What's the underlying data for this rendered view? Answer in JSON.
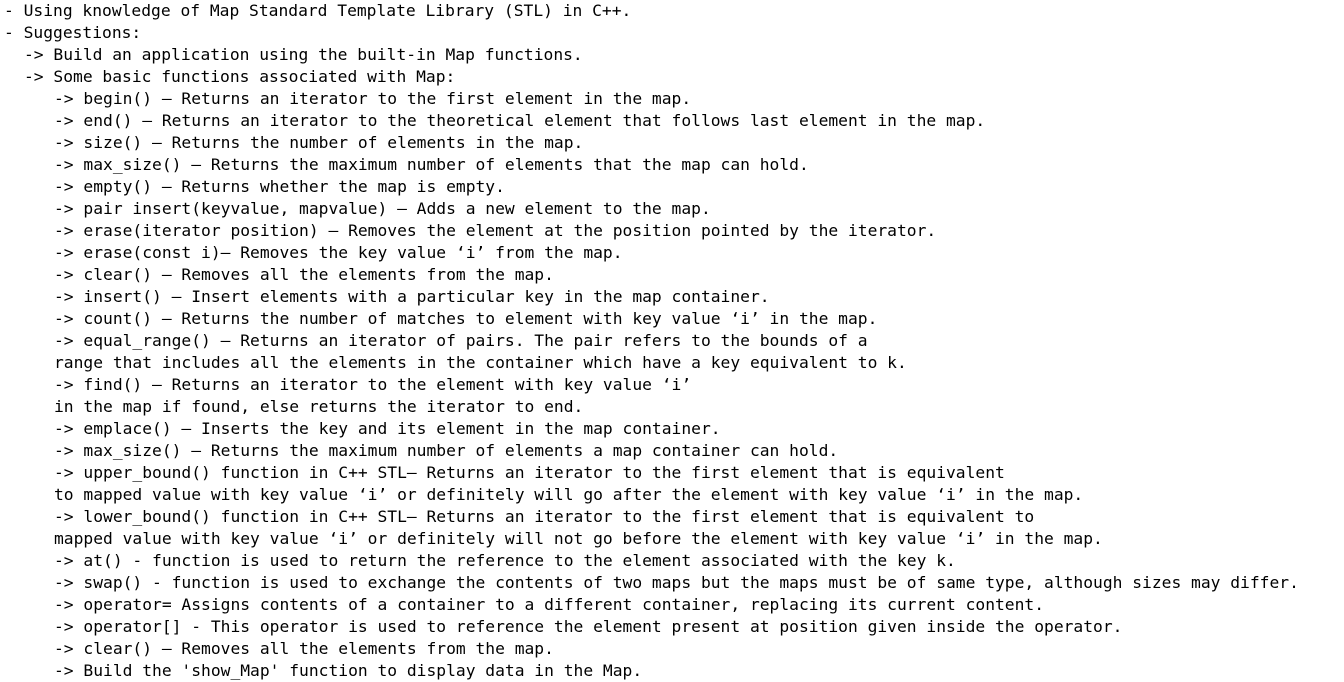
{
  "document": {
    "lines": [
      "- Using knowledge of Map Standard Template Library (STL) in C++.",
      "- Suggestions:",
      "-> Build an application using the built-in Map functions.",
      "-> Some basic functions associated with Map:",
      "-> begin() – Returns an iterator to the first element in the map.",
      "-> end() – Returns an iterator to the theoretical element that follows last element in the map.",
      "-> size() – Returns the number of elements in the map.",
      "-> max_size() – Returns the maximum number of elements that the map can hold.",
      "-> empty() – Returns whether the map is empty.",
      "-> pair insert(keyvalue, mapvalue) – Adds a new element to the map.",
      "-> erase(iterator position) – Removes the element at the position pointed by the iterator.",
      "-> erase(const i)– Removes the key value ‘i’ from the map.",
      "-> clear() – Removes all the elements from the map.",
      "-> insert() – Insert elements with a particular key in the map container.",
      "-> count() – Returns the number of matches to element with key value ‘i’ in the map.",
      "-> equal_range() – Returns an iterator of pairs. The pair refers to the bounds of a",
      "range that includes all the elements in the container which have a key equivalent to k.",
      "-> find() – Returns an iterator to the element with key value ‘i’",
      "in the map if found, else returns the iterator to end.",
      "-> emplace() – Inserts the key and its element in the map container.",
      "-> max_size() – Returns the maximum number of elements a map container can hold.",
      "-> upper_bound() function in C++ STL– Returns an iterator to the first element that is equivalent",
      "to mapped value with key value ‘i’ or definitely will go after the element with key value ‘i’ in the map.",
      "-> lower_bound() function in C++ STL– Returns an iterator to the first element that is equivalent to",
      "mapped value with key value ‘i’ or definitely will not go before the element with key value ‘i’ in the map.",
      "-> at() - function is used to return the reference to the element associated with the key k.",
      "-> swap() - function is used to exchange the contents of two maps but the maps must be of same type, although sizes may differ.",
      "-> operator= Assigns contents of a container to a different container, replacing its current content.",
      "-> operator[] - This operator is used to reference the element present at position given inside the operator.",
      "-> clear() – Removes all the elements from the map.",
      "-> Build the 'show_Map' function to display data in the Map."
    ]
  }
}
